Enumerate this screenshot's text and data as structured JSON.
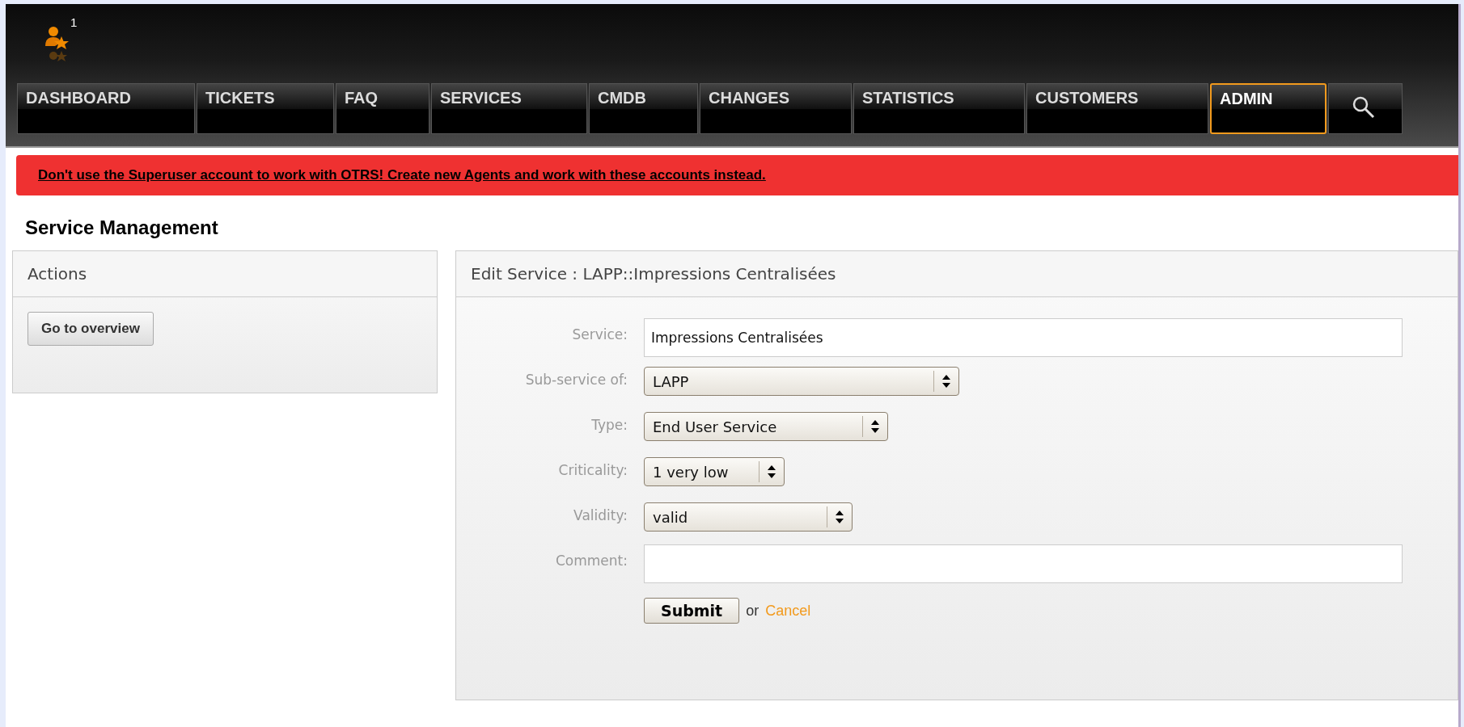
{
  "header": {
    "user_badge": "1"
  },
  "nav": [
    {
      "label": "DASHBOARD",
      "selected": false
    },
    {
      "label": "TICKETS",
      "selected": false
    },
    {
      "label": "FAQ",
      "selected": false
    },
    {
      "label": "SERVICES",
      "selected": false
    },
    {
      "label": "CMDB",
      "selected": false
    },
    {
      "label": "CHANGES",
      "selected": false
    },
    {
      "label": "STATISTICS",
      "selected": false
    },
    {
      "label": "CUSTOMERS",
      "selected": false
    },
    {
      "label": "ADMIN",
      "selected": true
    },
    {
      "kind": "search",
      "selected": false
    }
  ],
  "notice": "Don't use the Superuser account to work with OTRS! Create new Agents and work with these accounts instead.",
  "page_title": "Service Management",
  "actions_panel": {
    "title": "Actions",
    "buttons": [
      "Go to overview"
    ]
  },
  "edit_panel": {
    "title": "Edit Service : LAPP::Impressions Centralisées",
    "fields": [
      {
        "label": "Service:",
        "kind": "text",
        "value": "Impressions Centralisées"
      },
      {
        "label": "Sub-service of:",
        "kind": "select",
        "value": "LAPP"
      },
      {
        "label": "Type:",
        "kind": "select",
        "value": "End User Service"
      },
      {
        "label": "Criticality:",
        "kind": "select",
        "value": "1 very low"
      },
      {
        "label": "Validity:",
        "kind": "select",
        "value": "valid"
      },
      {
        "label": "Comment:",
        "kind": "text"
      }
    ],
    "submit": "Submit",
    "or": "or",
    "cancel": "Cancel"
  }
}
